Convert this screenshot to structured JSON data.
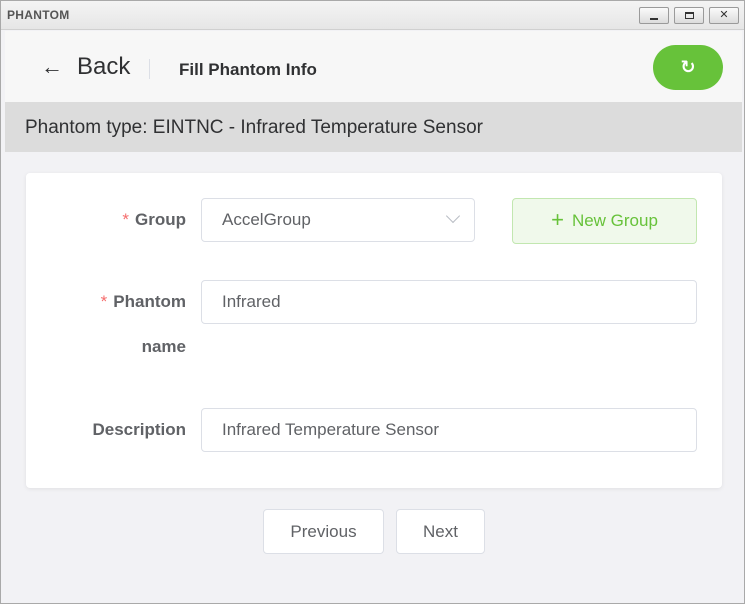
{
  "window": {
    "title": "PHANTOM",
    "minimize_icon": "minimize-icon",
    "maximize_icon": "maximize-icon",
    "close_icon": "close-icon",
    "close_glyph": "✕"
  },
  "header": {
    "back_arrow": "←",
    "back_label": "Back",
    "title": "Fill Phantom Info",
    "refresh_icon": "refresh-icon",
    "refresh_glyph": "↻",
    "accent_color": "#67c23a"
  },
  "type_bar": {
    "text": "Phantom type: EINTNC - Infrared Temperature Sensor"
  },
  "form": {
    "required_mark": "*",
    "group": {
      "label": "Group",
      "value": "AccelGroup"
    },
    "new_group": {
      "plus": "+",
      "label": "New Group"
    },
    "phantom_name": {
      "label_line1": "Phantom",
      "label_line2": "name",
      "value": "Infrared"
    },
    "description": {
      "label": "Description",
      "value": "Infrared Temperature Sensor"
    }
  },
  "footer": {
    "previous_label": "Previous",
    "next_label": "Next"
  }
}
